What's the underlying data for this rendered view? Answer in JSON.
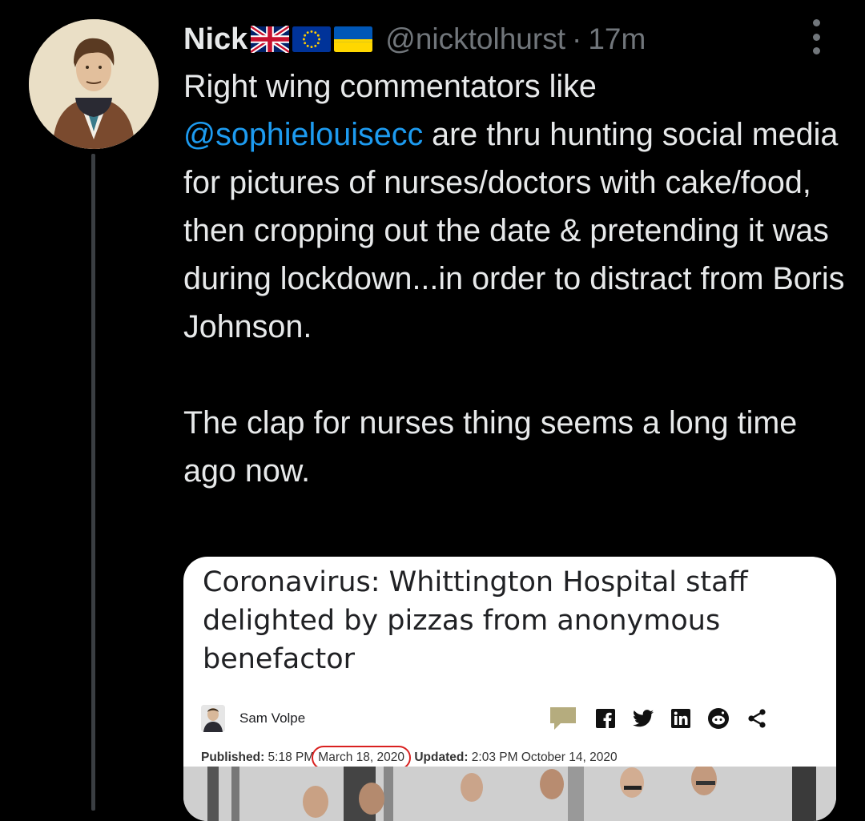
{
  "tweet": {
    "display_name": "Nick",
    "flags": [
      "uk-flag-icon",
      "eu-flag-icon",
      "ukraine-flag-icon"
    ],
    "handle": "@nicktolhurst",
    "separator": "·",
    "time": "17m",
    "text_part1": "Right wing commentators like",
    "mention": "@sophielouisecc",
    "text_part2": " are thru hunting social media for pictures of nurses/doctors with cake/food, then cropping out the date & pretending it was during lockdown...in order to distract from Boris Johnson.",
    "text_part3": "The clap for nurses thing seems a long time ago now."
  },
  "card": {
    "headline": "Coronavirus: Whittington Hospital staff delighted by pizzas from anonymous benefactor",
    "author": "Sam Volpe",
    "published_label": "Published:",
    "published_time": "5:18 PM",
    "published_date": "March 18, 2020",
    "updated_label": "Updated:",
    "updated_value": "2:03 PM October 14, 2020",
    "share_icons": [
      "comment-icon",
      "facebook-icon",
      "twitter-icon",
      "linkedin-icon",
      "reddit-icon",
      "share-icon"
    ]
  },
  "colors": {
    "background": "#000000",
    "text": "#e7e9ea",
    "muted": "#71767b",
    "link": "#1d9bf0",
    "circle": "#d9201f"
  }
}
